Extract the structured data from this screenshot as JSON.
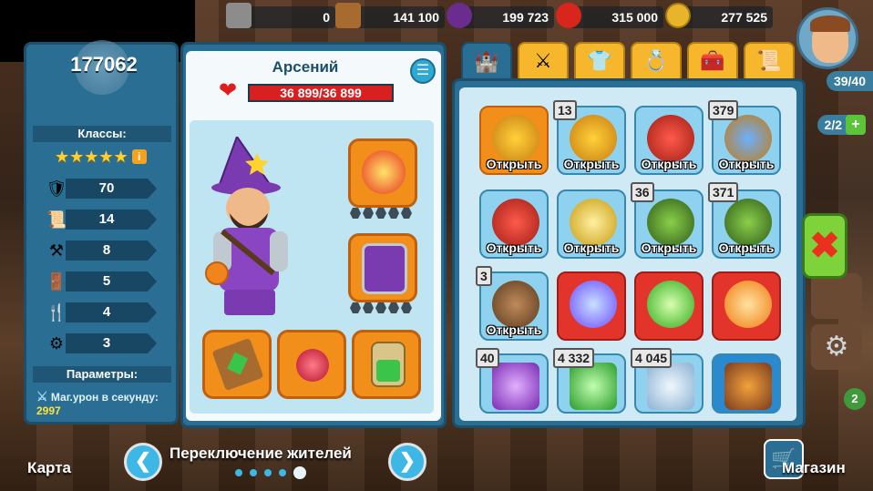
{
  "resources": [
    {
      "name": "stone",
      "value": "0"
    },
    {
      "name": "wood",
      "value": "141 100"
    },
    {
      "name": "eggplant",
      "value": "199 723"
    },
    {
      "name": "apple",
      "value": "315 000"
    },
    {
      "name": "coins",
      "value": "277 525"
    }
  ],
  "right_hud": {
    "population": "39/40",
    "builders": "2/2",
    "notifications": "2"
  },
  "stats_panel": {
    "score": "177062",
    "classes_title": "Классы:",
    "stars": "★★★★★",
    "info": "i",
    "stats": [
      {
        "icon": "shield-icon",
        "glyph": "🛡",
        "value": "70"
      },
      {
        "icon": "scroll-potion-icon",
        "glyph": "📜",
        "value": "14"
      },
      {
        "icon": "tools-icon",
        "glyph": "⚒",
        "value": "8"
      },
      {
        "icon": "door-icon",
        "glyph": "🚪",
        "value": "5"
      },
      {
        "icon": "food-icon",
        "glyph": "🍴",
        "value": "4"
      },
      {
        "icon": "anvil-icon",
        "glyph": "⚙",
        "value": "3"
      }
    ],
    "params_title": "Параметры:",
    "param_label": "Маг.урон в секунду:",
    "param_value": "2997"
  },
  "character": {
    "name": "Арсений",
    "hp": "36 899/36 899"
  },
  "inventory": {
    "open_label": "Открыть",
    "counts": {
      "pineapple_gold": "13",
      "trident": "379",
      "horned_green": "36",
      "horned_green2": "371",
      "chest": "3",
      "purple_crystal": "40",
      "green_crystal": "4 332",
      "blue_crystal": "4 045"
    }
  },
  "bottom": {
    "map": "Карта",
    "switch": "Переключение жителей",
    "shop": "Магазин"
  },
  "colors": {
    "panel": "#2a6f93",
    "accent": "#f6b72c",
    "hp": "#d82020"
  }
}
